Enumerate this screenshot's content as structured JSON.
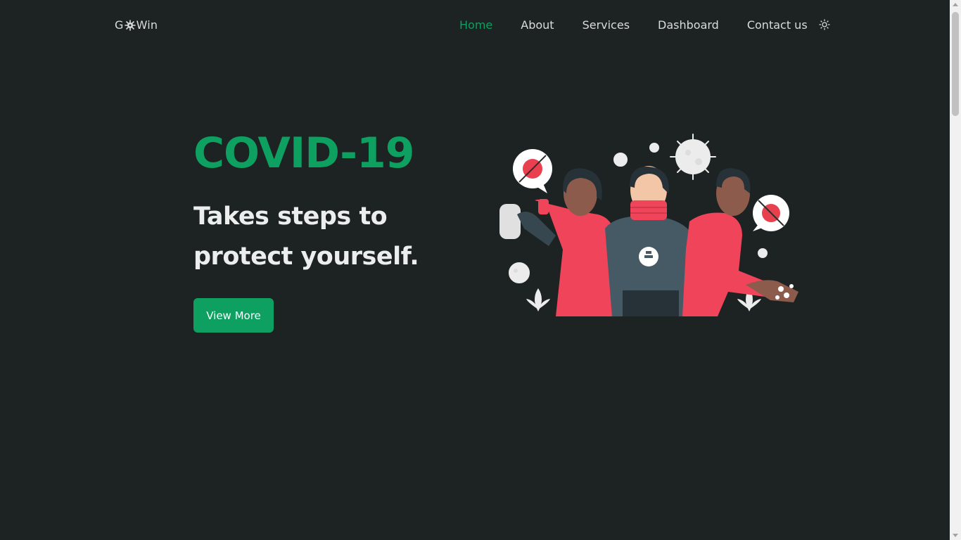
{
  "logo": {
    "prefix": "G",
    "suffix": "Win",
    "icon": "virus-icon"
  },
  "nav": {
    "items": [
      {
        "label": "Home",
        "active": true
      },
      {
        "label": "About"
      },
      {
        "label": "Services"
      },
      {
        "label": "Dashboard"
      },
      {
        "label": "Contact us"
      }
    ],
    "theme_icon": "sun-icon"
  },
  "hero": {
    "title": "COVID-19",
    "subtitle_line1": "Takes steps to",
    "subtitle_line2": "protect yourself.",
    "cta_label": "View More",
    "illustration": "people-protecting-from-virus-illustration"
  },
  "colors": {
    "background": "#1d2322",
    "accent": "#0ea061",
    "text": "#eceeee",
    "illustration_red": "#f0445a",
    "illustration_dark": "#37474f"
  }
}
